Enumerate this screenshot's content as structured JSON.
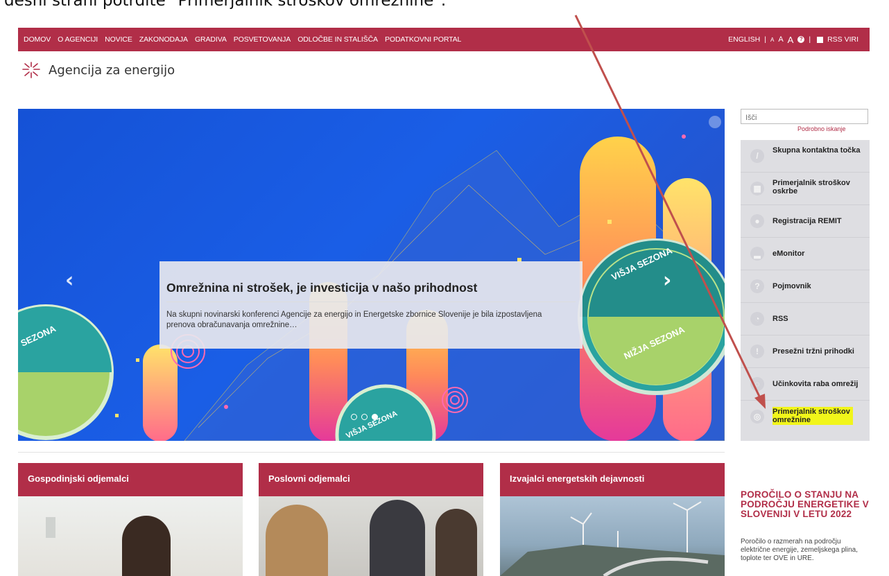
{
  "instruction": "desni strani potrdite \"Primerjalnik stroškov omrežnine\".",
  "nav": {
    "items": [
      "DOMOV",
      "O AGENCIJI",
      "NOVICE",
      "ZAKONODAJA",
      "GRADIVA",
      "POSVETOVANJA",
      "ODLOČBE IN STALIŠČA",
      "PODATKOVNI PORTAL"
    ],
    "english": "ENGLISH",
    "sep1": "|",
    "font_small": "A",
    "font_med": "A",
    "font_large": "A",
    "help": "?",
    "sep2": "|",
    "rss": "RSS VIRI"
  },
  "logo": {
    "text": "Agencija za energijo"
  },
  "slider": {
    "title": "Omrežnina ni strošek, je investicija v našo prihodnost",
    "text": "Na skupni novinarski konferenci Agencije za energijo in Energetske zbornice Slovenije je bila izpostavljena prenova obračunavanja omrežnine…",
    "arrow_left": "‹",
    "arrow_right": "›",
    "badge_top": "VIŠJA SEZONA",
    "badge_bottom": "NIŽJA SEZONA",
    "badge_left": "SEZONA",
    "badge_center": "VIŠJA SEZONA"
  },
  "search": {
    "placeholder": "Išči",
    "advanced": "Podrobno iskanje"
  },
  "sidebar": {
    "items": [
      {
        "label": "Skupna kontaktna točka",
        "icon": "pencil-icon"
      },
      {
        "label": "Primerjalnik stroškov oskrbe",
        "icon": "calculator-icon"
      },
      {
        "label": "Registracija REMIT",
        "icon": "user-icon"
      },
      {
        "label": "eMonitor",
        "icon": "bar-chart-icon"
      },
      {
        "label": "Pojmovnik",
        "icon": "question-icon"
      },
      {
        "label": "RSS",
        "icon": "rss-icon"
      },
      {
        "label": "Presežni tržni prihodki",
        "icon": "exclamation-icon"
      },
      {
        "label": "Učinkovita raba omrežij",
        "icon": "gauge-icon"
      },
      {
        "label": "Primerjalnik stroškov omrežnine",
        "icon": "network-icon"
      }
    ]
  },
  "cards": [
    {
      "title": "Gospodinjski odjemalci"
    },
    {
      "title": "Poslovni odjemalci"
    },
    {
      "title": "Izvajalci energetskih dejavnosti"
    }
  ],
  "report": {
    "title": "POROČILO O STANJU NA PODROČJU ENERGETIKE V SLOVENIJI V LETU 2022",
    "text": "Poročilo o razmerah na področju električne energije, zemeljskega plina, toplote ter OVE in URE."
  },
  "colors": {
    "brand": "#b12e48",
    "highlight": "#f1f51a",
    "annotation": "#c0504d"
  }
}
